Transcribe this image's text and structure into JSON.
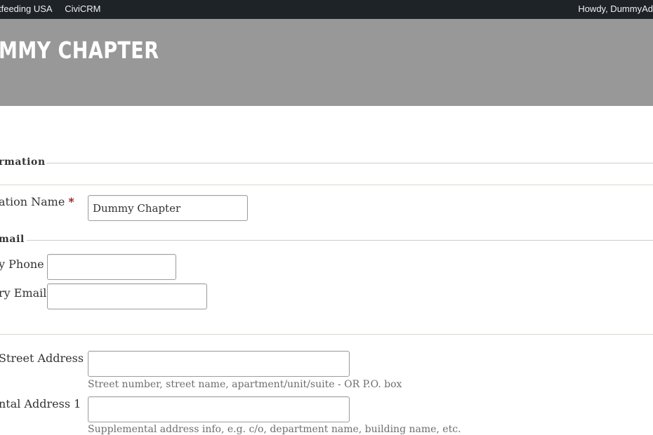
{
  "adminbar": {
    "site_name": "tfeeding USA",
    "civicrm": "CiviCRM",
    "howdy": "Howdy, DummyAd"
  },
  "banner": {
    "title": "MMY CHAPTER"
  },
  "sections": {
    "information": "rmation",
    "email": "mail"
  },
  "form": {
    "org_name": {
      "label": "ation Name",
      "required_mark": "*",
      "value": "Dummy Chapter"
    },
    "phone": {
      "label": "y Phone",
      "value": ""
    },
    "email": {
      "label": "ry Email",
      "value": ""
    },
    "street": {
      "label": "Street Address",
      "value": "",
      "help": "Street number, street name, apartment/unit/suite - OR P.O. box"
    },
    "supplemental": {
      "label": "ntal Address 1",
      "value": "",
      "help": "Supplemental address info, e.g. c/o, department name, building name, etc."
    }
  }
}
